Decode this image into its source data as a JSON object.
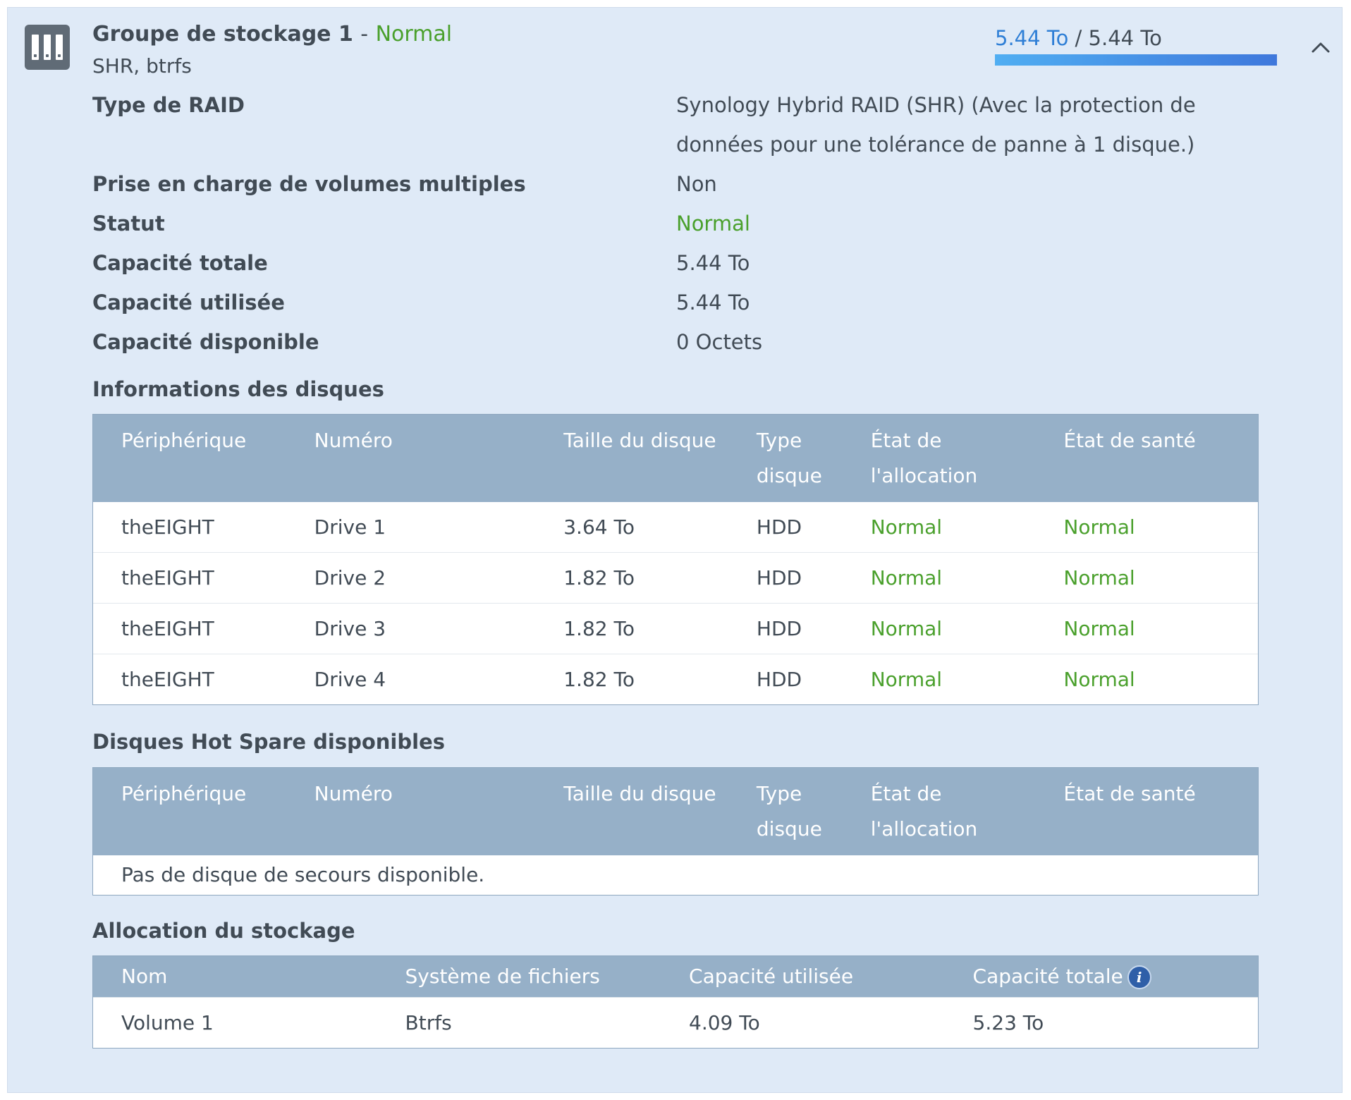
{
  "header": {
    "title": "Groupe de stockage 1",
    "separator": "-",
    "status": "Normal",
    "subtitle": "SHR, btrfs",
    "usage_used": "5.44 To",
    "usage_sep": "/",
    "usage_total": "5.44 To",
    "usage_fraction": 1.0,
    "collapse_icon": "chevron-up-icon"
  },
  "properties": [
    {
      "label": "Type de RAID",
      "value": "Synology Hybrid RAID (SHR) (Avec la protection de données pour une tolérance de panne à 1 disque.)"
    },
    {
      "label": "Prise en charge de volumes multiples",
      "value": "Non"
    },
    {
      "label": "Statut",
      "value": "Normal"
    },
    {
      "label": "Capacité totale",
      "value": "5.44 To"
    },
    {
      "label": "Capacité utilisée",
      "value": "5.44 To"
    },
    {
      "label": "Capacité disponible",
      "value": "0 Octets"
    }
  ],
  "disks": {
    "title": "Informations des disques",
    "columns": [
      "Périphérique",
      "Numéro",
      "Taille du disque",
      "Type disque",
      "État de l'allocation",
      "État de santé"
    ],
    "rows": [
      [
        "theEIGHT",
        "Drive 1",
        "3.64 To",
        "HDD",
        "Normal",
        "Normal"
      ],
      [
        "theEIGHT",
        "Drive 2",
        "1.82 To",
        "HDD",
        "Normal",
        "Normal"
      ],
      [
        "theEIGHT",
        "Drive 3",
        "1.82 To",
        "HDD",
        "Normal",
        "Normal"
      ],
      [
        "theEIGHT",
        "Drive 4",
        "1.82 To",
        "HDD",
        "Normal",
        "Normal"
      ]
    ]
  },
  "hotspare": {
    "title": "Disques Hot Spare disponibles",
    "columns": [
      "Périphérique",
      "Numéro",
      "Taille du disque",
      "Type disque",
      "État de l'allocation",
      "État de santé"
    ],
    "empty_message": "Pas de disque de secours disponible."
  },
  "allocation": {
    "title": "Allocation du stockage",
    "columns": [
      "Nom",
      "Système de fichiers",
      "Capacité utilisée",
      "Capacité totale"
    ],
    "rows": [
      [
        "Volume 1",
        "Btrfs",
        "4.09 To",
        "5.23 To"
      ]
    ],
    "info_icon": "i"
  },
  "colors": {
    "panel_bg": "#dfeaf7",
    "table_header": "#96b0c8",
    "status_green": "#4aa02c",
    "accent_blue": "#2f7fd6"
  }
}
